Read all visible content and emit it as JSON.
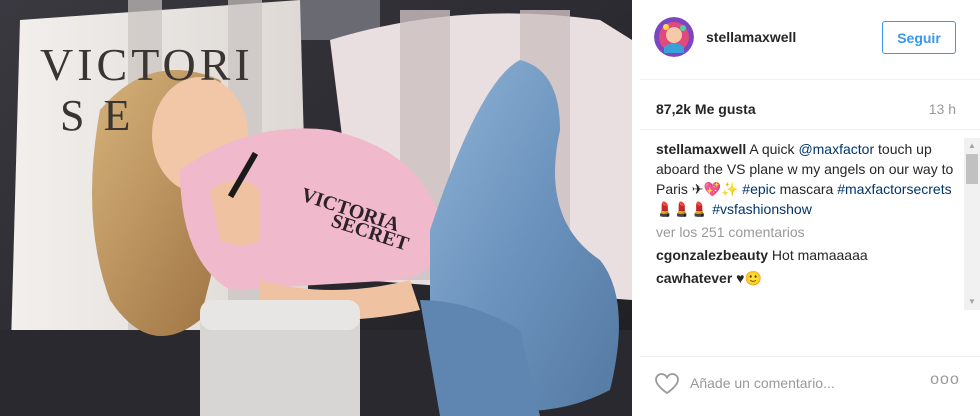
{
  "photo": {
    "description_icon": "post-photo"
  },
  "header": {
    "username": "stellamaxwell",
    "follow_label": "Seguir"
  },
  "stats": {
    "likes": "87,2k Me gusta",
    "time_ago": "13 h"
  },
  "caption": {
    "username": "stellamaxwell",
    "text1": " A quick ",
    "mention": "@maxfactor",
    "text2": " touch up aboard the VS plane w my angels on our way to Paris ✈💖✨ ",
    "hashtag1": "#epic",
    "text3": " mascara ",
    "hashtag2": "#maxfactorsecrets💄💄💄",
    "text4": " ",
    "hashtag3": "#vsfashionshow"
  },
  "view_comments": "ver los 251 comentarios",
  "comments": [
    {
      "user": "cgonzalezbeauty",
      "text": "Hot mamaaaaa"
    },
    {
      "user": "cawhatever",
      "text": "♥🙂"
    }
  ],
  "footer": {
    "comment_placeholder": "Añade un comentario...",
    "more_label": "ooo"
  },
  "colors": {
    "link": "#003569",
    "accent": "#3897f0",
    "muted": "#999999"
  }
}
